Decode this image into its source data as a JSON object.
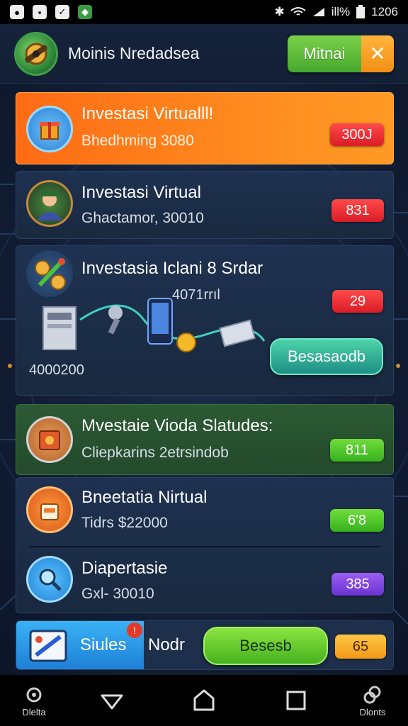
{
  "status_bar": {
    "time": "1206",
    "battery": "ill%"
  },
  "header": {
    "title": "Moinis Nredadsea",
    "button_label": "Mitnai",
    "close_glyph": "✕"
  },
  "cards": [
    {
      "title": "Investasi Virtualll!",
      "subtitle": "Bhedhming 3080",
      "badge": "300J",
      "icon": "gift-box-icon"
    },
    {
      "title": "Investasi Virtual",
      "subtitle": "Ghactamor, 30010",
      "badge": "831",
      "icon": "avatar-icon"
    },
    {
      "title": "Investasia Iclani 8 Srdar",
      "mid_value": "4071rrıl",
      "left_value": "4000200",
      "badge": "29",
      "action": "Besasaodb",
      "icon": "coins-icon"
    },
    {
      "title": "Mvestaie Vioda Slatudes:",
      "subtitle": "Cliepkarins 2etrsindob",
      "badge": "811",
      "icon": "wallet-icon"
    },
    {
      "title": "Bneetatia Nirtual",
      "subtitle": "Tidrs $22000",
      "badge": "6ʹ8",
      "icon": "shop-icon"
    },
    {
      "title": "Diapertasie",
      "subtitle": "Gxl- 30010",
      "badge": "385",
      "icon": "magnifier-icon"
    }
  ],
  "bottom_bar": {
    "tab_label": "Siules",
    "notification_badge": "!",
    "side_text": "Nodr",
    "action": "Besesb",
    "badge": "65"
  },
  "nav": {
    "left_label": "Dlelta",
    "right_label": "Dlonts"
  },
  "colors": {
    "accent_orange": "#ff7a1a",
    "accent_green": "#46a82e",
    "background": "#14213a"
  }
}
